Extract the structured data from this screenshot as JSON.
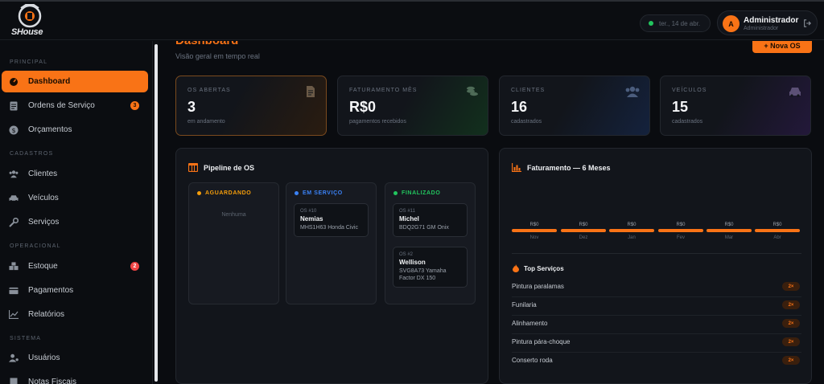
{
  "header": {
    "logo_text": "SHouse",
    "date": "ter., 14 de abr.",
    "user": {
      "initial": "A",
      "name": "Administrador",
      "role": "Administrador"
    }
  },
  "sidebar": {
    "sections": {
      "principal": "PRINCIPAL",
      "cadastros": "CADASTROS",
      "operacional": "OPERACIONAL",
      "sistema": "SISTEMA"
    },
    "items": [
      {
        "label": "Dashboard",
        "icon": "gauge-icon",
        "active": true
      },
      {
        "label": "Ordens de Serviço",
        "icon": "document-icon",
        "badge": "3"
      },
      {
        "label": "Orçamentos",
        "icon": "money-icon"
      },
      {
        "label": "Clientes",
        "icon": "users-icon"
      },
      {
        "label": "Veículos",
        "icon": "car-icon"
      },
      {
        "label": "Serviços",
        "icon": "wrench-icon"
      },
      {
        "label": "Estoque",
        "icon": "boxes-icon",
        "badge": "2"
      },
      {
        "label": "Pagamentos",
        "icon": "wallet-icon"
      },
      {
        "label": "Relatórios",
        "icon": "chart-icon"
      },
      {
        "label": "Usuários",
        "icon": "user-cog-icon"
      },
      {
        "label": "Notas Fiscais",
        "icon": "receipt-icon"
      }
    ]
  },
  "page": {
    "title": "Dashboard",
    "subtitle": "Visão geral em tempo real",
    "new_button": "+ Nova OS"
  },
  "stats": [
    {
      "label": "OS ABERTAS",
      "value": "3",
      "sub": "em andamento",
      "icon": "file-icon",
      "color": "#f97316"
    },
    {
      "label": "FATURAMENTO MÊS",
      "value": "R$0",
      "sub": "pagamentos recebidos",
      "icon": "coins-icon",
      "color": "#22c55e"
    },
    {
      "label": "CLIENTES",
      "value": "16",
      "sub": "cadastrados",
      "icon": "users-icon",
      "color": "#3b82f6"
    },
    {
      "label": "VEÍCULOS",
      "value": "15",
      "sub": "cadastrados",
      "icon": "car-icon",
      "color": "#8b5cf6"
    }
  ],
  "pipeline": {
    "title": "Pipeline de OS",
    "columns": [
      {
        "label": "AGUARDANDO",
        "color": "#f59e0b",
        "empty": "Nenhuma",
        "cards": []
      },
      {
        "label": "EM SERVIÇO",
        "color": "#3b82f6",
        "cards": [
          {
            "id": "OS #10",
            "name": "Nemias",
            "vehicle": "MHS1H63 Honda Civic"
          }
        ]
      },
      {
        "label": "FINALIZADO",
        "color": "#22c55e",
        "cards": [
          {
            "id": "OS #11",
            "name": "Michel",
            "vehicle": "BDQ2G71 GM Onix"
          },
          {
            "id": "OS #2",
            "name": "Wellison",
            "vehicle": "SVG8A73 Yamaha Factor DX 150"
          }
        ]
      }
    ]
  },
  "revenue": {
    "title": "Faturamento — 6 Meses",
    "months": [
      {
        "label": "Nov",
        "value": "R$0"
      },
      {
        "label": "Dez",
        "value": "R$0"
      },
      {
        "label": "Jan",
        "value": "R$0"
      },
      {
        "label": "Fev",
        "value": "R$0"
      },
      {
        "label": "Mar",
        "value": "R$0"
      },
      {
        "label": "Abr",
        "value": "R$0"
      }
    ],
    "top_title": "Top Serviços",
    "top_services": [
      {
        "name": "Pintura paralamas",
        "count": "2×"
      },
      {
        "name": "Funilaria",
        "count": "2×"
      },
      {
        "name": "Alinhamento",
        "count": "2×"
      },
      {
        "name": "Pintura pára-choque",
        "count": "2×"
      },
      {
        "name": "Conserto roda",
        "count": "2×"
      }
    ]
  }
}
